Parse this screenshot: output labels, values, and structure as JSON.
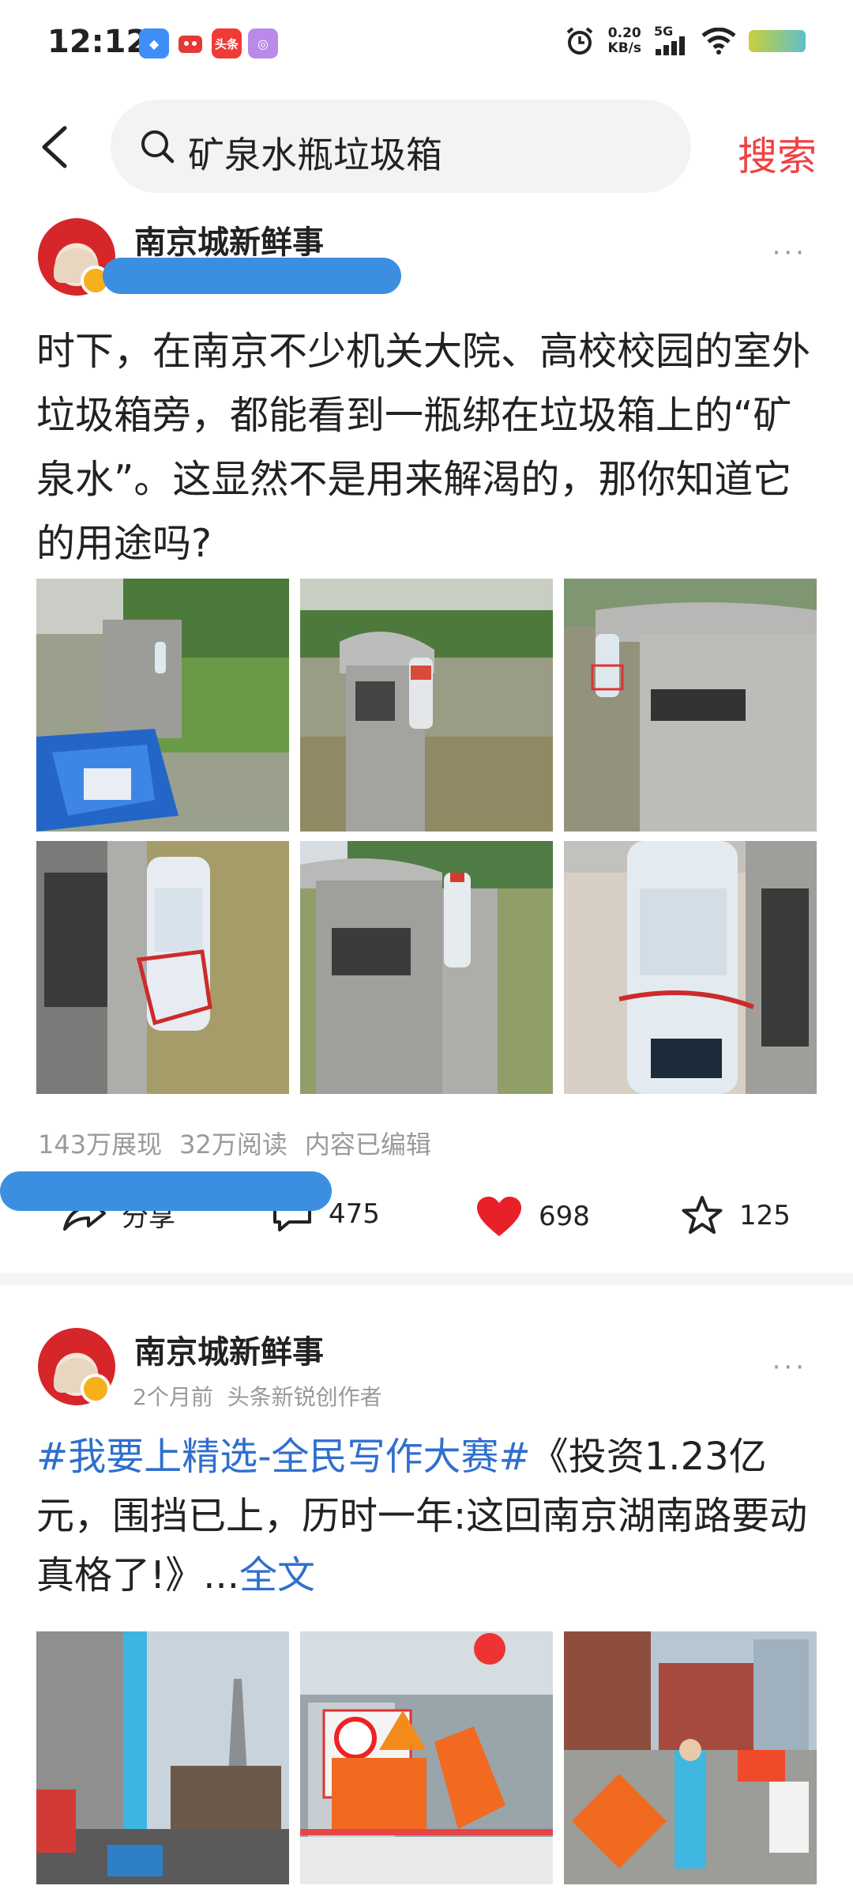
{
  "status_bar": {
    "time": "12:12",
    "net_speed_value": "0.20",
    "net_speed_unit": "KB/s",
    "network": "5G",
    "app_icon_toutiao": "头条"
  },
  "header": {
    "search_query": "矿泉水瓶垃圾箱",
    "search_button": "搜索"
  },
  "posts": [
    {
      "author": "南京城新鲜事",
      "more": "···",
      "text": "时下，在南京不少机关大院、高校校园的室外垃圾箱旁，都能看到一瓶绑在垃圾箱上的“矿泉水”。这显然不是用来解渴的，那你知道它的用途吗?",
      "stats": {
        "impressions": "143万展现",
        "reads": "32万阅读",
        "edited": "内容已编辑"
      },
      "actions": {
        "share": "分享",
        "comments": "475",
        "likes": "698",
        "favorites": "125"
      }
    },
    {
      "author": "南京城新鲜事",
      "more": "···",
      "time_ago": "2个月前",
      "author_tag": "头条新锐创作者",
      "hashtag": "#我要上精选-全民写作大赛#",
      "text": "《投资1.23亿元，围挡已上，历时一年:这回南京湖南路要动真格了!》...",
      "full_text_link": "全文"
    }
  ],
  "colors": {
    "accent_red": "#f04142",
    "link_blue": "#2f6fce",
    "like_red": "#e8202a",
    "meta_gray": "#999999"
  }
}
